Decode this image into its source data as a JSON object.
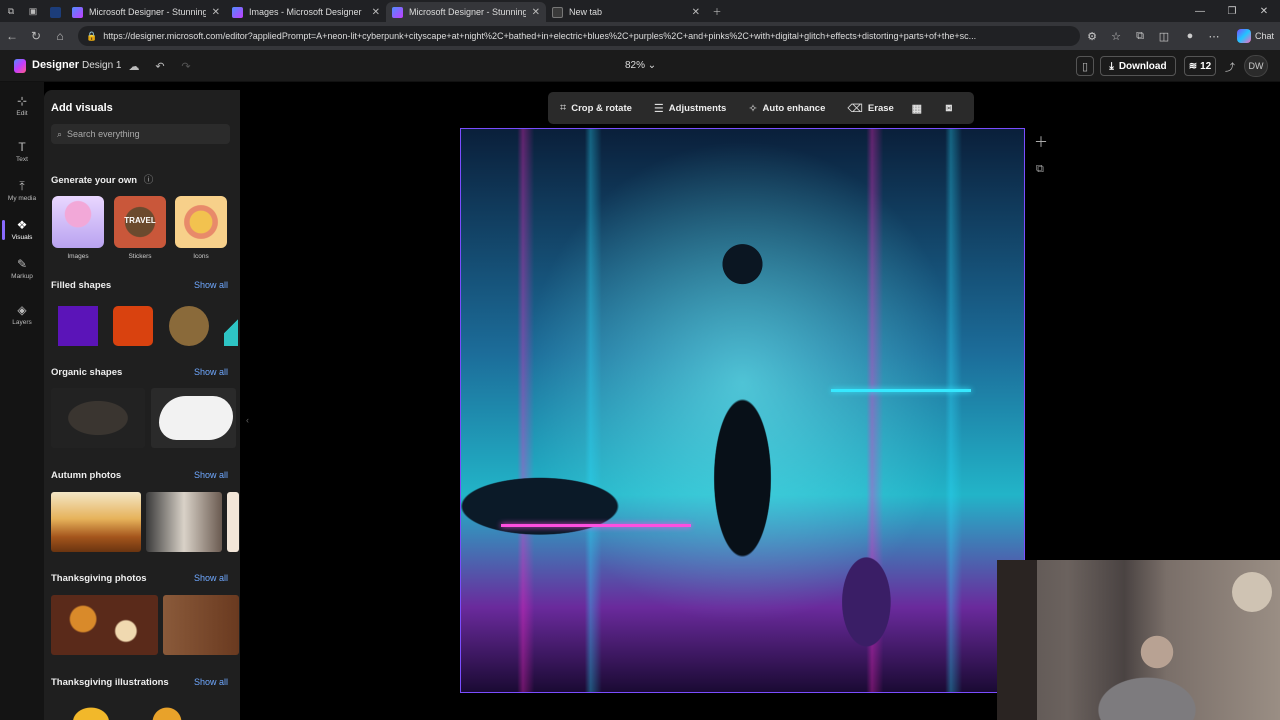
{
  "browser": {
    "tabs": [
      {
        "title": "Microsoft Designer - Stunning de",
        "active": false
      },
      {
        "title": "Images - Microsoft Designer",
        "active": false
      },
      {
        "title": "Microsoft Designer - Stunning de",
        "active": true
      },
      {
        "title": "New tab",
        "active": false
      }
    ],
    "url": "https://designer.microsoft.com/editor?appliedPrompt=A+neon-lit+cyberpunk+cityscape+at+night%2C+bathed+in+electric+blues%2C+purples%2C+and+pinks%2C+with+digital+glitch+effects+distorting+parts+of+the+sc...",
    "chat_label": "Chat"
  },
  "header": {
    "app_name": "Designer",
    "design_name": "Design 1",
    "zoom": "82%",
    "download_label": "Download",
    "credits": "12",
    "avatar_initials": "DW"
  },
  "rail": [
    {
      "label": "Edit",
      "icon": "edit-icon"
    },
    {
      "label": "Text",
      "icon": "text-icon"
    },
    {
      "label": "My media",
      "icon": "upload-icon"
    },
    {
      "label": "Visuals",
      "icon": "visuals-icon",
      "active": true
    },
    {
      "label": "Markup",
      "icon": "pen-icon"
    },
    {
      "label": "Layers",
      "icon": "layers-icon"
    }
  ],
  "panel": {
    "title": "Add visuals",
    "search_placeholder": "Search everything",
    "generate_title": "Generate your own",
    "generate_items": [
      "Images",
      "Stickers",
      "Icons"
    ],
    "sticker_badge": "TRAVEL",
    "show_all": "Show all",
    "sections": [
      "Filled shapes",
      "Organic shapes",
      "Autumn photos",
      "Thanksgiving photos",
      "Thanksgiving illustrations"
    ],
    "shape_colors": [
      "#5b14b8",
      "#d9420f",
      "#8a6a3a",
      "#2ec4c4"
    ]
  },
  "toolbar": {
    "crop": "Crop & rotate",
    "adjust": "Adjustments",
    "enhance": "Auto enhance",
    "erase": "Erase"
  }
}
